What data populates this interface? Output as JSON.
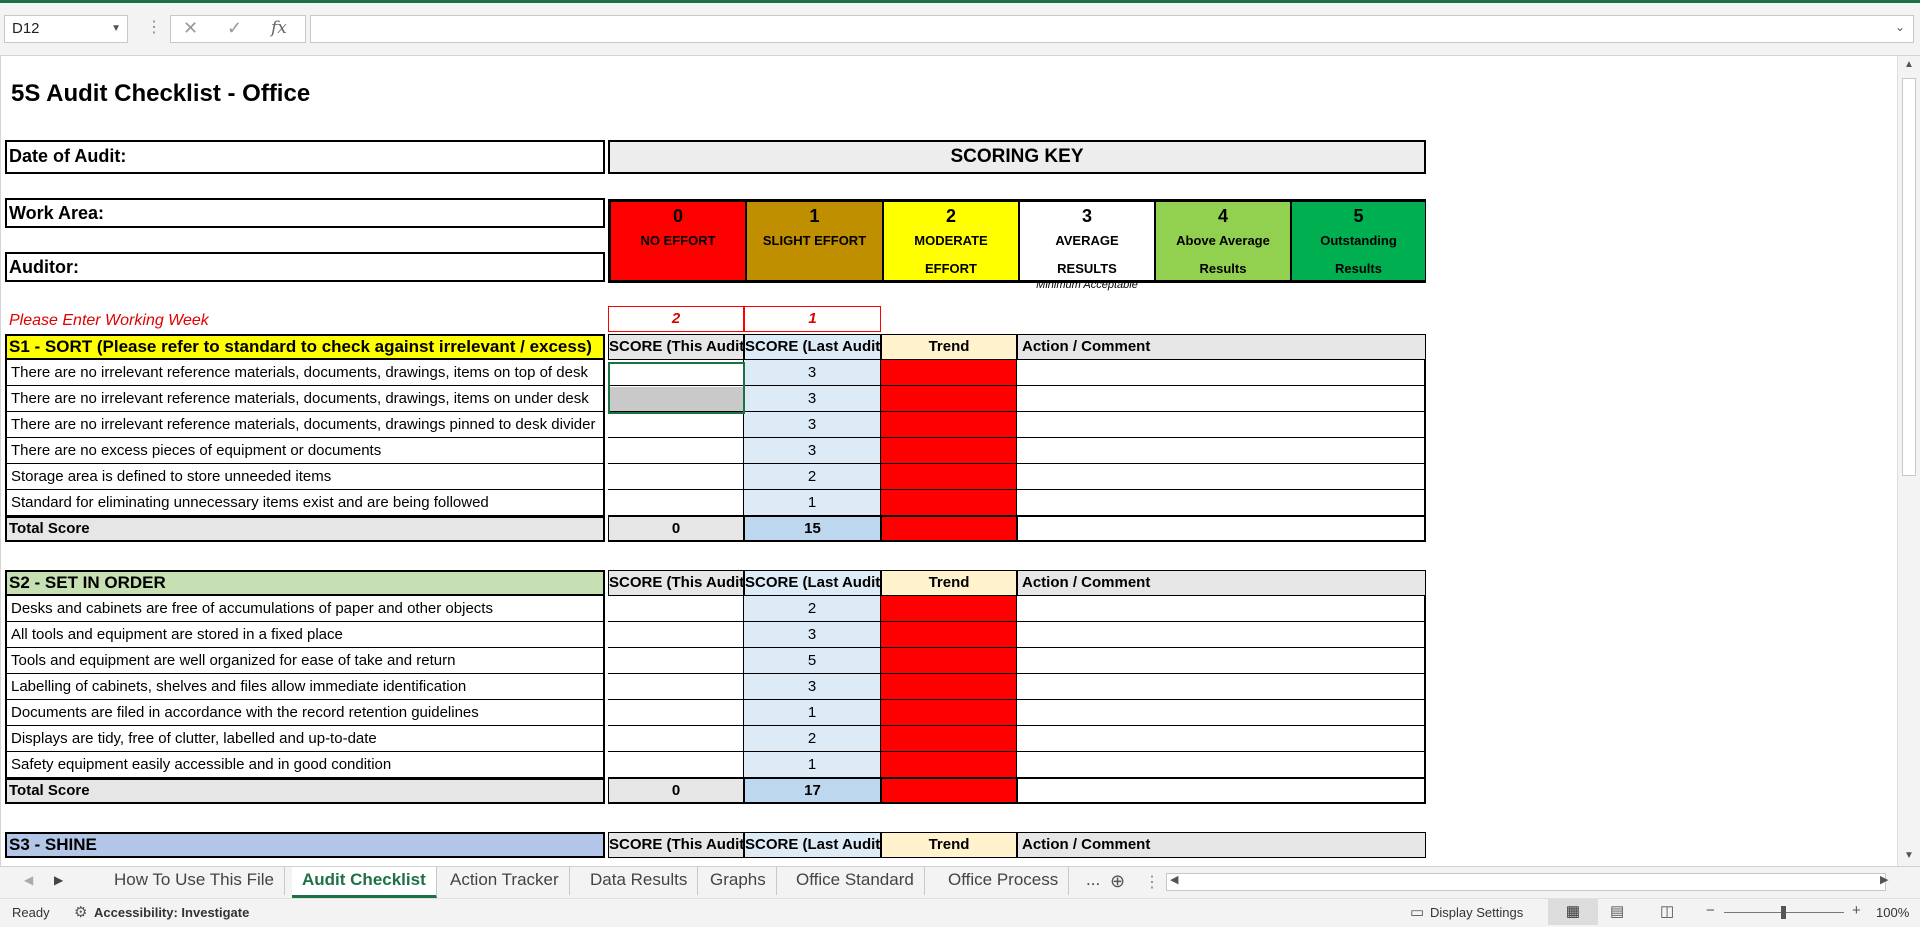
{
  "formula_bar": {
    "name_box": "D12",
    "cancel_icon": "✕",
    "enter_icon": "✓",
    "fx_label": "fx",
    "formula": ""
  },
  "sheet": {
    "title": "5S Audit Checklist - Office",
    "date_label": "Date of Audit:",
    "work_area_label": "Work Area:",
    "auditor_label": "Auditor:",
    "scoring_key_title": "SCORING KEY",
    "scoring_key": [
      {
        "num": "0",
        "text": "NO EFFORT",
        "sub": "",
        "color": "#ff0000"
      },
      {
        "num": "1",
        "text": "SLIGHT EFFORT",
        "sub": "",
        "color": "#bf8f00"
      },
      {
        "num": "2",
        "text": "MODERATE EFFORT",
        "sub": "",
        "color": "#ffff00"
      },
      {
        "num": "3",
        "text": "AVERAGE RESULTS",
        "sub": "Minimum Acceptable",
        "color": "#ffffff"
      },
      {
        "num": "4",
        "text": "Above Average Results",
        "sub": "",
        "color": "#92d050"
      },
      {
        "num": "5",
        "text": "Outstanding Results",
        "sub": "",
        "color": "#00b050"
      }
    ],
    "working_week_label": "Please Enter Working Week",
    "working_week_this": "2",
    "working_week_last": "1",
    "col_headers": {
      "this": "SCORE (This Audit)",
      "last": "SCORE (Last Audit)",
      "trend": "Trend",
      "action": "Action / Comment"
    },
    "total_label": "Total Score",
    "sections": [
      {
        "title": "S1 - SORT (Please refer to standard to check against irrelevant / excess)",
        "color": "#ffff00",
        "items": [
          {
            "text": "There are no irrelevant reference materials, documents, drawings, items on top of desk",
            "this": "",
            "last": "3"
          },
          {
            "text": "There are no irrelevant reference materials, documents, drawings, items on under desk",
            "this": "",
            "last": "3"
          },
          {
            "text": "There are no irrelevant reference materials, documents, drawings pinned to desk divider",
            "this": "",
            "last": "3"
          },
          {
            "text": "There are no excess pieces of equipment or documents",
            "this": "",
            "last": "3"
          },
          {
            "text": "Storage area is defined to store unneeded items",
            "this": "",
            "last": "2"
          },
          {
            "text": "Standard for eliminating unnecessary items exist and are being followed",
            "this": "",
            "last": "1"
          }
        ],
        "total_this": "0",
        "total_last": "15"
      },
      {
        "title": "S2 - SET IN ORDER",
        "color": "#c6e0b4",
        "items": [
          {
            "text": "Desks and cabinets are free of accumulations of paper and other objects",
            "this": "",
            "last": "2"
          },
          {
            "text": "All tools and equipment are stored in a fixed place",
            "this": "",
            "last": "3"
          },
          {
            "text": "Tools and equipment are well organized for ease of take and return",
            "this": "",
            "last": "5"
          },
          {
            "text": "Labelling of cabinets, shelves and files allow immediate identification",
            "this": "",
            "last": "3"
          },
          {
            "text": "Documents are filed in accordance with the record retention guidelines",
            "this": "",
            "last": "1"
          },
          {
            "text": "Displays are tidy, free of clutter, labelled and up-to-date",
            "this": "",
            "last": "2"
          },
          {
            "text": "Safety equipment easily accessible and in good condition",
            "this": "",
            "last": "1"
          }
        ],
        "total_this": "0",
        "total_last": "17"
      },
      {
        "title": "S3 - SHINE",
        "color": "#b4c6e7",
        "items": [],
        "total_this": "",
        "total_last": ""
      }
    ]
  },
  "tabs": [
    "How To Use This File",
    "Audit Checklist",
    "Action Tracker",
    "Data Results",
    "Graphs",
    "Office Standard",
    "Office Process",
    "..."
  ],
  "active_tab": "Audit Checklist",
  "status": {
    "ready": "Ready",
    "accessibility": "Accessibility: Investigate",
    "display_settings": "Display Settings",
    "zoom": "100%"
  }
}
